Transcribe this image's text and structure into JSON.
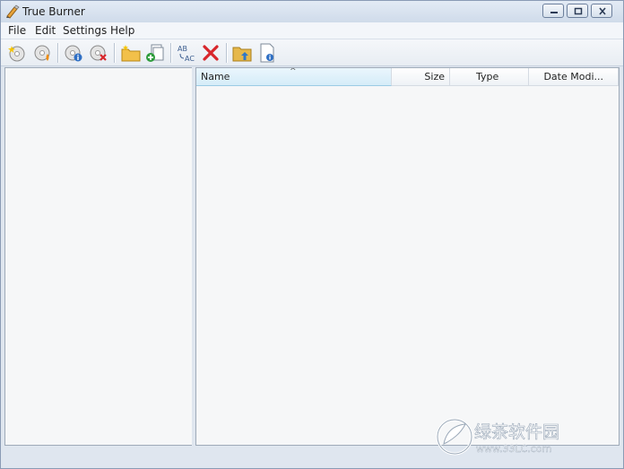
{
  "window": {
    "title": "True Burner"
  },
  "menu": {
    "file": "File",
    "edit": "Edit",
    "settings": "Settings",
    "help": "Help"
  },
  "toolbar": {
    "icons": [
      "new-disc-icon",
      "burn-disc-icon",
      "disc-info-icon",
      "erase-disc-icon",
      "new-folder-icon",
      "add-files-icon",
      "rename-icon",
      "delete-icon",
      "folder-up-icon",
      "file-properties-icon"
    ]
  },
  "file_list": {
    "columns": [
      {
        "label": "Name",
        "sorted": true
      },
      {
        "label": "Size"
      },
      {
        "label": "Type"
      },
      {
        "label": "Date Modi..."
      }
    ],
    "rows": []
  },
  "watermark": {
    "text": "绿茶软件园",
    "url": "www.33LC.com"
  },
  "colors": {
    "window_frame": "#dfe6ef",
    "pane_background": "#f6f7f8",
    "sorted_header": "#d5ecf8"
  }
}
